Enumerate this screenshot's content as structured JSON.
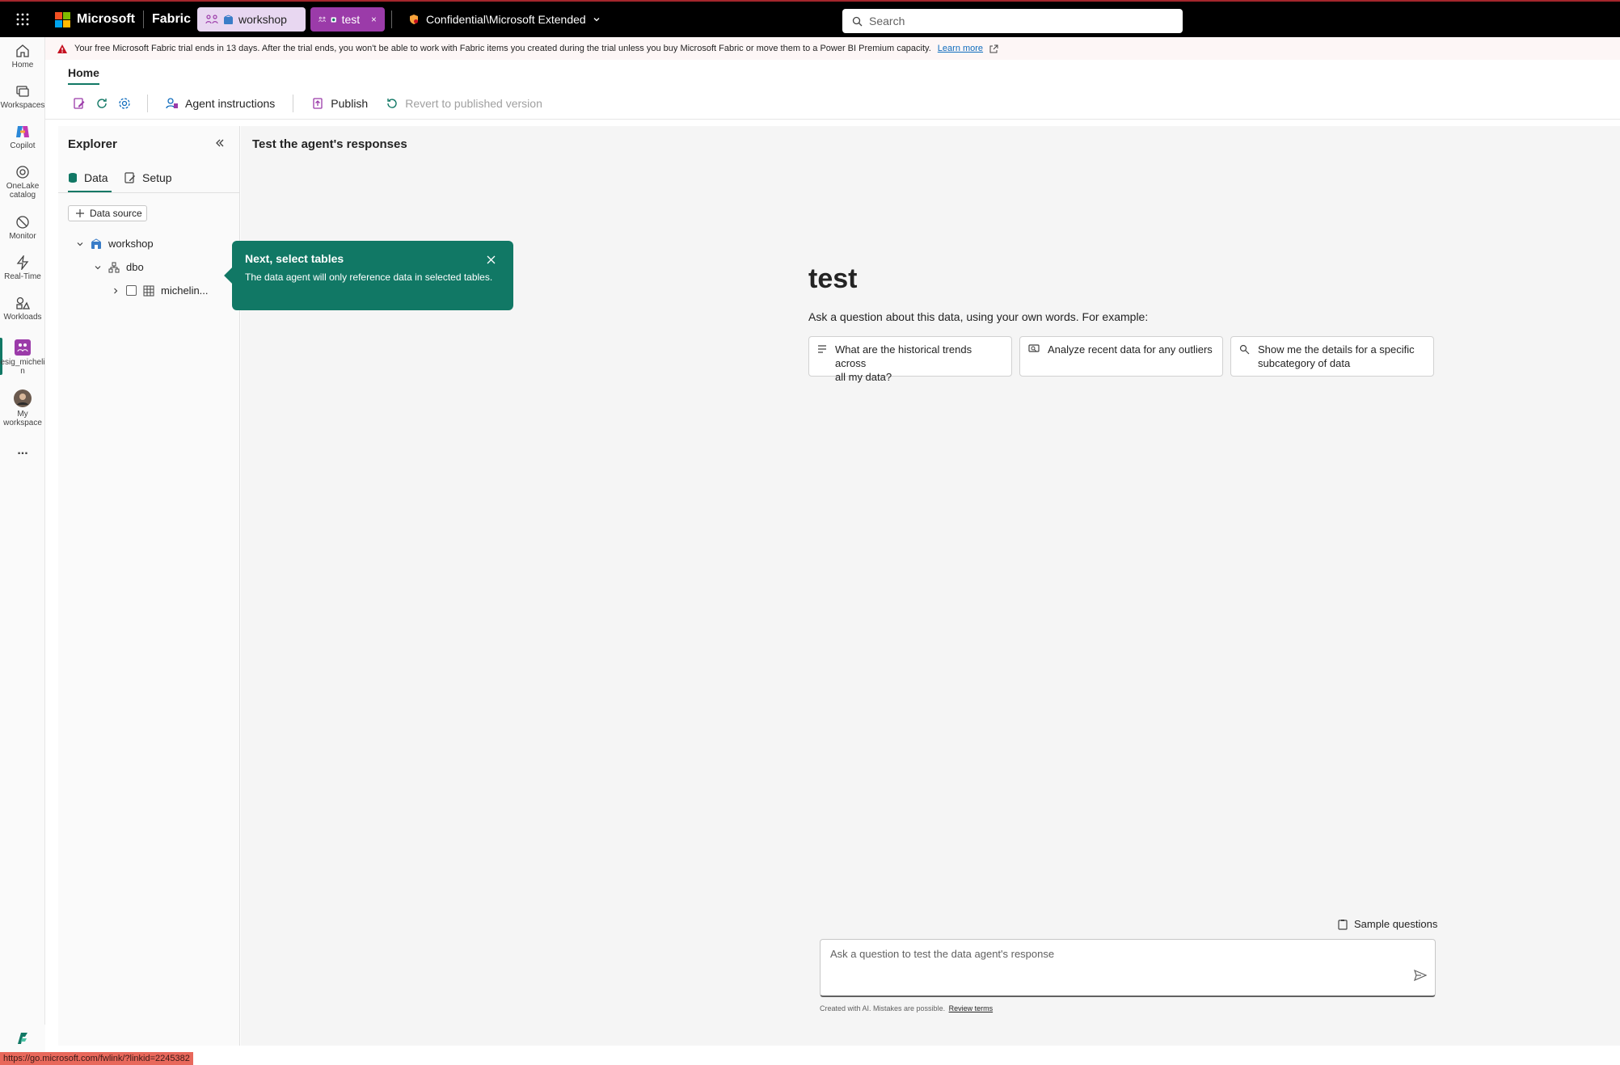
{
  "topbar": {
    "brand": "Microsoft",
    "product": "Fabric",
    "tabs": [
      {
        "label": "workshop"
      },
      {
        "label": "test"
      }
    ],
    "sensitivity_label": "Confidential\\Microsoft Extended",
    "search_placeholder": "Search"
  },
  "rail": {
    "items": [
      {
        "label": "Home",
        "icon": "home-icon"
      },
      {
        "label": "Workspaces",
        "icon": "workspaces-icon"
      },
      {
        "label": "Copilot",
        "icon": "copilot-icon"
      },
      {
        "label_line1": "OneLake",
        "label_line2": "catalog",
        "icon": "onelake-icon"
      },
      {
        "label": "Monitor",
        "icon": "monitor-icon"
      },
      {
        "label": "Real-Time",
        "icon": "realtime-icon"
      },
      {
        "label": "Workloads",
        "icon": "workloads-icon"
      },
      {
        "label_line1": "esig_micheli",
        "label_line2": "n",
        "icon": "agent-icon"
      },
      {
        "label_line1": "My",
        "label_line2": "workspace",
        "icon": "avatar-icon"
      }
    ],
    "more": "..."
  },
  "banner": {
    "message": "Your free Microsoft Fabric trial ends in 13 days. After the trial ends, you won't be able to work with Fabric items you created during the trial unless you buy Microsoft Fabric or move them to a Power BI Premium capacity.",
    "link": "Learn more"
  },
  "ribbon": {
    "tab": "Home",
    "agent_instructions": "Agent instructions",
    "publish": "Publish",
    "revert": "Revert to published version"
  },
  "explorer": {
    "title": "Explorer",
    "tabs": [
      "Data",
      "Setup"
    ],
    "data_source_button": "Data source",
    "tree": {
      "workspace": "workshop",
      "schema": "dbo",
      "table": "michelin..."
    }
  },
  "teaching_bubble": {
    "title": "Next, select tables",
    "body": "The data agent will only reference data in selected tables."
  },
  "main": {
    "title": "Test the agent's responses",
    "agent_name": "test",
    "prompt": "Ask a question about this data, using your own words. For example:",
    "suggestions": [
      {
        "line1": "What are the historical trends across",
        "line2": "all my data?"
      },
      {
        "line1": "Analyze recent data for any outliers",
        "line2": ""
      },
      {
        "line1": "Show me the details for a specific",
        "line2": "subcategory of data"
      }
    ],
    "sample_questions": "Sample questions",
    "chat_placeholder": "Ask a question to test the data agent's response",
    "disclaimer": "Created with AI. Mistakes are possible.",
    "review_terms": "Review terms"
  },
  "status_url": "https://go.microsoft.com/fwlink/?linkid=2245382",
  "colors": {
    "accent": "#117865",
    "tab_active": "#9b3ba9",
    "tab_inactive": "#e8d7f1",
    "warning": "#c50f1f"
  }
}
